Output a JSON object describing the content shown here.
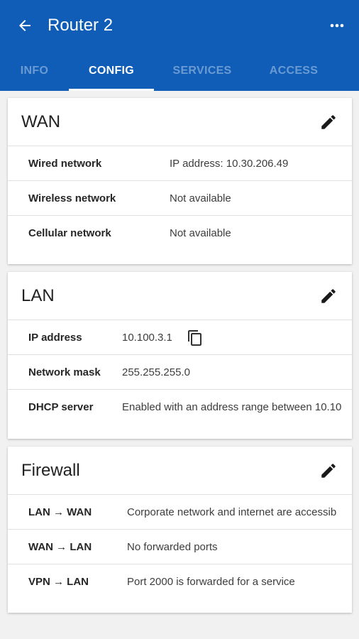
{
  "toolbar": {
    "title": "Router 2",
    "back_icon": "arrow-back-icon",
    "more_icon": "more-horizontal-icon",
    "background_color": "#0f5db7"
  },
  "tabs": [
    {
      "label": "INFO",
      "active": false
    },
    {
      "label": "CONFIG",
      "active": true
    },
    {
      "label": "SERVICES",
      "active": false
    },
    {
      "label": "ACCESS",
      "active": false
    }
  ],
  "wan": {
    "title": "WAN",
    "edit_icon": "pencil-icon",
    "rows": [
      {
        "label": "Wired network",
        "value": "IP address: 10.30.206.49"
      },
      {
        "label": "Wireless network",
        "value": "Not available"
      },
      {
        "label": "Cellular network",
        "value": "Not available"
      }
    ]
  },
  "lan": {
    "title": "LAN",
    "edit_icon": "pencil-icon",
    "copy_icon": "copy-icon",
    "rows": [
      {
        "label": "IP address",
        "value": "10.100.3.1"
      },
      {
        "label": "Network mask",
        "value": "255.255.255.0"
      },
      {
        "label": "DHCP server",
        "value": "Enabled with an address range between 10.10"
      }
    ]
  },
  "firewall": {
    "title": "Firewall",
    "edit_icon": "pencil-icon",
    "rows": [
      {
        "label": "LAN → WAN",
        "value": "Corporate network and internet are accessib"
      },
      {
        "label": "WAN → LAN",
        "value": "No forwarded ports"
      },
      {
        "label": "VPN → LAN",
        "value": "Port 2000 is forwarded for a service"
      }
    ]
  }
}
